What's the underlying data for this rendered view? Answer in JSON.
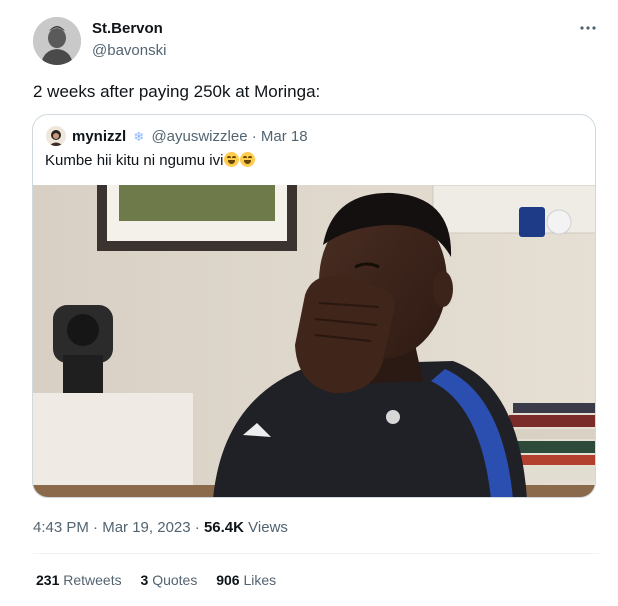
{
  "author": {
    "name": "St.Bervon",
    "handle": "@bavonski"
  },
  "tweet_text": "2 weeks after paying 250k at Moringa:",
  "quoted": {
    "name": "mynizzl",
    "handle": "@ayuswizzlee",
    "separator": "·",
    "date": "Mar 18",
    "text": "Kumbe hii kitu ni ngumu ivi"
  },
  "meta": {
    "time": "4:43 PM",
    "separator": "·",
    "date": "Mar 19, 2023",
    "separator2": "·",
    "views_count": "56.4K",
    "views_label": "Views"
  },
  "stats": {
    "retweets_count": "231",
    "retweets_label": "Retweets",
    "quotes_count": "3",
    "quotes_label": "Quotes",
    "likes_count": "906",
    "likes_label": "Likes"
  },
  "icons": {
    "more": "more-horizontal-icon",
    "snowflake": "snowflake-icon",
    "emoji": "face-with-tears-of-joy-icon"
  }
}
